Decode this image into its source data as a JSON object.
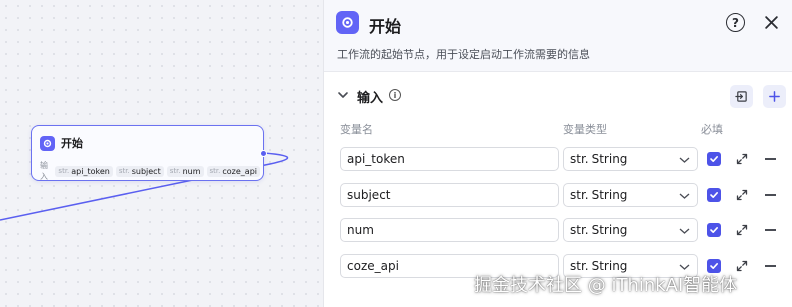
{
  "canvas": {
    "node": {
      "title": "开始",
      "input_label": "输入",
      "params": [
        {
          "type": "str.",
          "name": "api_token"
        },
        {
          "type": "str.",
          "name": "subject"
        },
        {
          "type": "str.",
          "name": "num"
        },
        {
          "type": "str.",
          "name": "coze_api"
        }
      ]
    }
  },
  "panel": {
    "title": "开始",
    "help_icon": "?",
    "description": "工作流的起始节点，用于设定启动工作流需要的信息",
    "section": {
      "title": "输入",
      "info_icon": "i",
      "columns": {
        "name": "变量名",
        "type": "变量类型",
        "required": "必填"
      },
      "variables": [
        {
          "name": "api_token",
          "type_prefix": "str.",
          "type": "String",
          "required": true
        },
        {
          "name": "subject",
          "type_prefix": "str.",
          "type": "String",
          "required": true
        },
        {
          "name": "num",
          "type_prefix": "str.",
          "type": "String",
          "required": true
        },
        {
          "name": "coze_api",
          "type_prefix": "str.",
          "type": "String",
          "required": true
        }
      ]
    }
  },
  "watermark": "掘金技术社区 @ iThinkAI智能体",
  "colors": {
    "accent": "#4d53e8",
    "node_border": "#6b72f0",
    "edge": "#5a5ff0",
    "icon_bg": "#6264f6"
  },
  "icons": {
    "node_icon": "start-icon",
    "header_icon": "start-icon",
    "help": "help-circle-icon",
    "close": "close-icon",
    "collapse": "chevron-down-icon",
    "info": "info-icon",
    "import": "import-icon",
    "add": "plus-icon",
    "expand": "expand-icon",
    "remove": "minus-icon"
  }
}
